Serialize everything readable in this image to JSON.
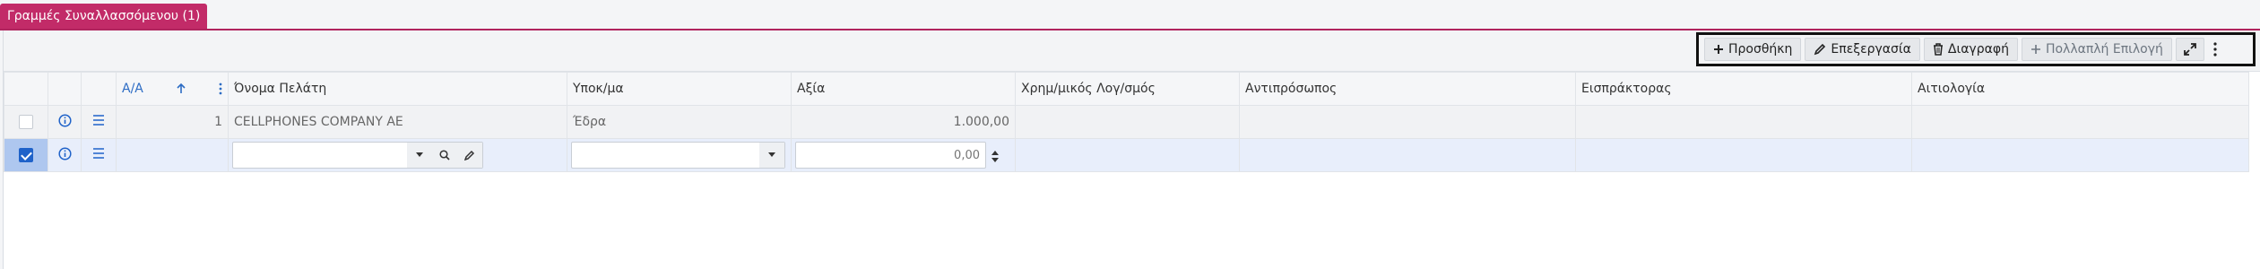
{
  "tab": {
    "label": "Γραμμές Συναλλασσόμενου (1)"
  },
  "toolbar": {
    "add_label": "Προσθήκη",
    "edit_label": "Επεξεργασία",
    "delete_label": "Διαγραφή",
    "multi_label": "Πολλαπλή Επιλογή",
    "icons": [
      "plus-icon",
      "pencil-icon",
      "trash-icon",
      "plus-icon",
      "expand-icon",
      "more-vertical-icon"
    ]
  },
  "columns": {
    "aa": "Α/Α",
    "customer": "Όνομα Πελάτη",
    "branch": "Υποκ/μα",
    "value": "Αξία",
    "account": "Χρημ/μικός Λογ/σμός",
    "representative": "Αντιπρόσωπος",
    "collector": "Εισπράκτορας",
    "reason": "Αιτιολογία"
  },
  "rows": [
    {
      "aa": "1",
      "customer": "CELLPHONES COMPANY AE",
      "branch": "Έδρα",
      "value": "1.000,00",
      "account": "",
      "representative": "",
      "collector": "",
      "reason": "",
      "checked": false
    }
  ],
  "new_row": {
    "value_placeholder": "0,00",
    "checked": true
  },
  "colors": {
    "accent": "#c22b68",
    "primary": "#1f62c9",
    "link": "#2d6cc4"
  }
}
